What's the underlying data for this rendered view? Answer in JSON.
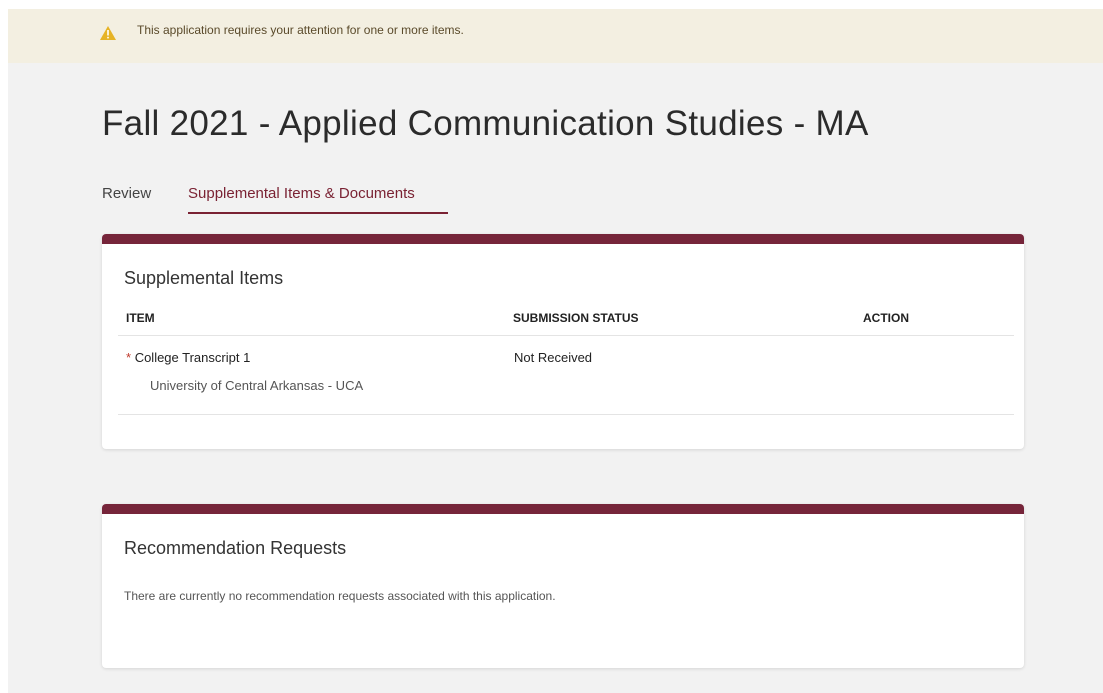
{
  "alert": {
    "icon": "warning-icon",
    "color": "#e6b325",
    "message": "This application requires your attention for one or more items."
  },
  "page": {
    "title": "Fall 2021 - Applied Communication Studies - MA"
  },
  "tabs": [
    {
      "label": "Review",
      "active": false
    },
    {
      "label": "Supplemental Items & Documents",
      "active": true
    }
  ],
  "colors": {
    "accent": "#76253a",
    "required": "#c0392b"
  },
  "supplemental": {
    "title": "Supplemental Items",
    "columns": {
      "item": "ITEM",
      "status": "SUBMISSION STATUS",
      "action": "ACTION"
    },
    "rows": [
      {
        "required_marker": "*",
        "item": "College Transcript 1",
        "institution": "University of Central Arkansas - UCA",
        "status": "Not Received",
        "action": ""
      }
    ]
  },
  "recommendations": {
    "title": "Recommendation Requests",
    "empty_message": "There are currently no recommendation requests associated with this application."
  }
}
